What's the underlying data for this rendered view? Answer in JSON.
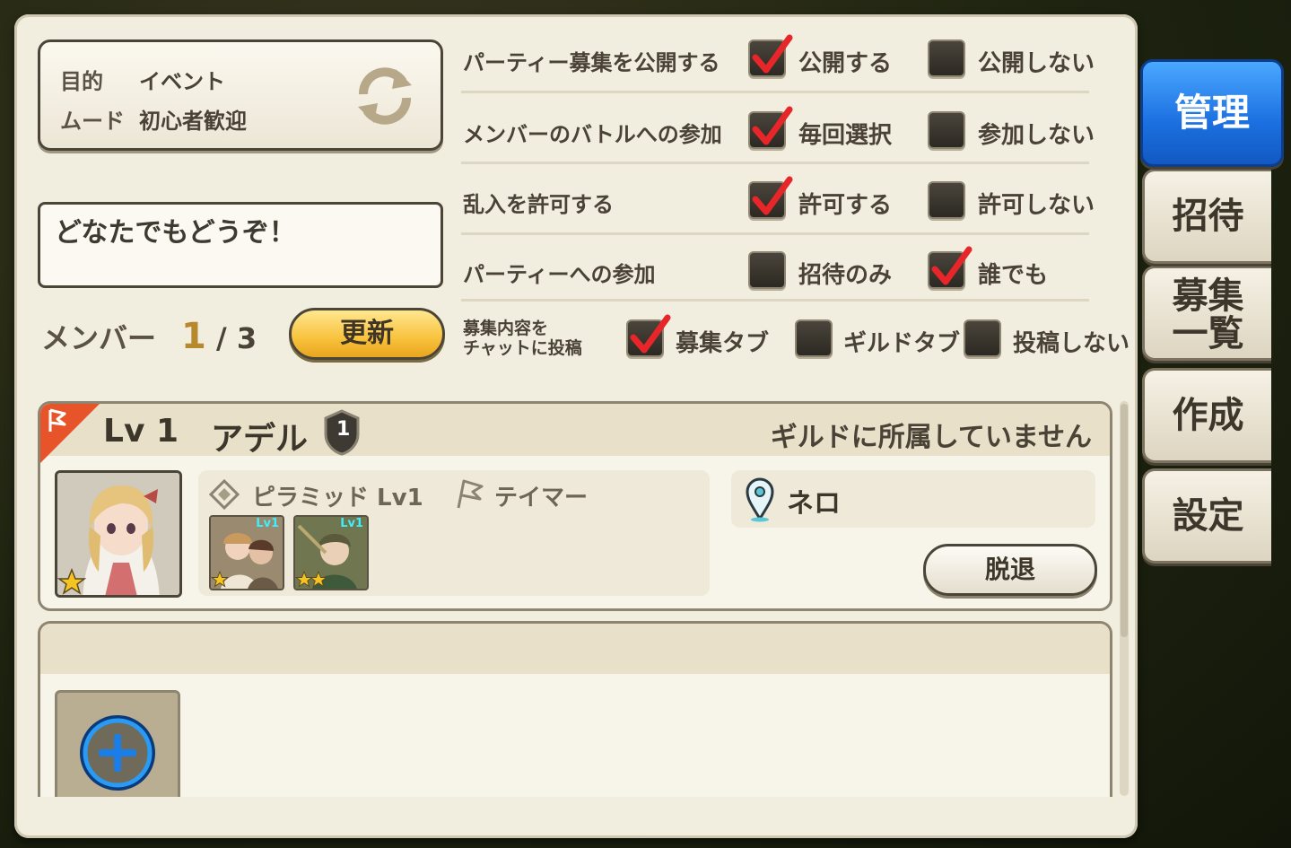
{
  "purpose": {
    "purpose_label": "目的",
    "purpose_value": "イベント",
    "mood_label": "ムード",
    "mood_value": "初心者歓迎"
  },
  "comment": "どなたでもどうぞ！",
  "members": {
    "label": "メンバー",
    "current": "1",
    "separator": "/",
    "max": "3"
  },
  "update_label": "更新",
  "settings": [
    {
      "label": "パーティー募集を公開する",
      "options": [
        {
          "text": "公開する",
          "checked": true
        },
        {
          "text": "公開しない",
          "checked": false
        }
      ]
    },
    {
      "label": "メンバーのバトルへの参加",
      "options": [
        {
          "text": "毎回選択",
          "checked": true
        },
        {
          "text": "参加しない",
          "checked": false
        }
      ]
    },
    {
      "label": "乱入を許可する",
      "options": [
        {
          "text": "許可する",
          "checked": true
        },
        {
          "text": "許可しない",
          "checked": false
        }
      ]
    },
    {
      "label": "パーティーへの参加",
      "options": [
        {
          "text": "招待のみ",
          "checked": false
        },
        {
          "text": "誰でも",
          "checked": true
        }
      ]
    }
  ],
  "post": {
    "label_line1": "募集内容を",
    "label_line2": "チャットに投稿",
    "options": [
      {
        "text": "募集タブ",
        "checked": true
      },
      {
        "text": "ギルドタブ",
        "checked": false
      },
      {
        "text": "投稿しない",
        "checked": false
      }
    ]
  },
  "tabs": {
    "manage": "管理",
    "invite": "招待",
    "list_line1": "募集",
    "list_line2": "一覧",
    "create": "作成",
    "settings": "設定"
  },
  "member": {
    "level": "Lv 1",
    "name": "アデル",
    "rank": "1",
    "guild_status": "ギルドに所属していません",
    "job": "ピラミッド Lv1",
    "role": "テイマー",
    "unit1_level": "Lv1",
    "unit2_level": "Lv1",
    "location": "ネロ",
    "leave_label": "脱退"
  },
  "colors": {
    "check_red": "#e8262a",
    "accent_blue": "#1b6fe0",
    "update_yellow": "#f8c23c"
  }
}
